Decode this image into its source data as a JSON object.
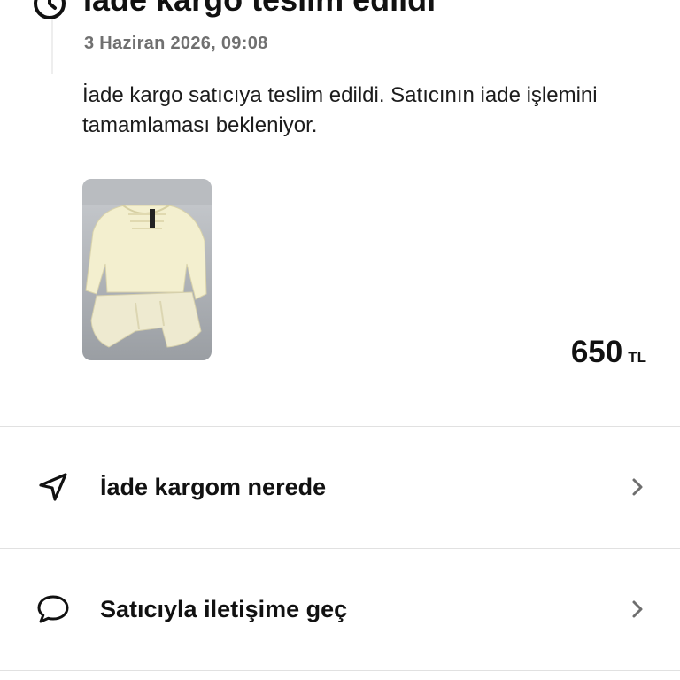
{
  "status": {
    "title": "İade kargo teslim edildi",
    "date": "3 Haziran 2026, 09:08",
    "description": "İade kargo satıcıya teslim edildi. Satıcının iade işlemini tamamlaması bekleniyor.",
    "icon": "clock-icon"
  },
  "product": {
    "price_amount": "650",
    "price_currency": "TL"
  },
  "actions": [
    {
      "label": "İade kargom nerede",
      "icon": "navigation-arrow-icon"
    },
    {
      "label": "Satıcıyla iletişime geç",
      "icon": "chat-bubble-icon"
    }
  ],
  "colors": {
    "text": "#111111",
    "secondary_text": "#707070",
    "divider": "#e1e1e1",
    "chevron": "#6e6e6e"
  }
}
